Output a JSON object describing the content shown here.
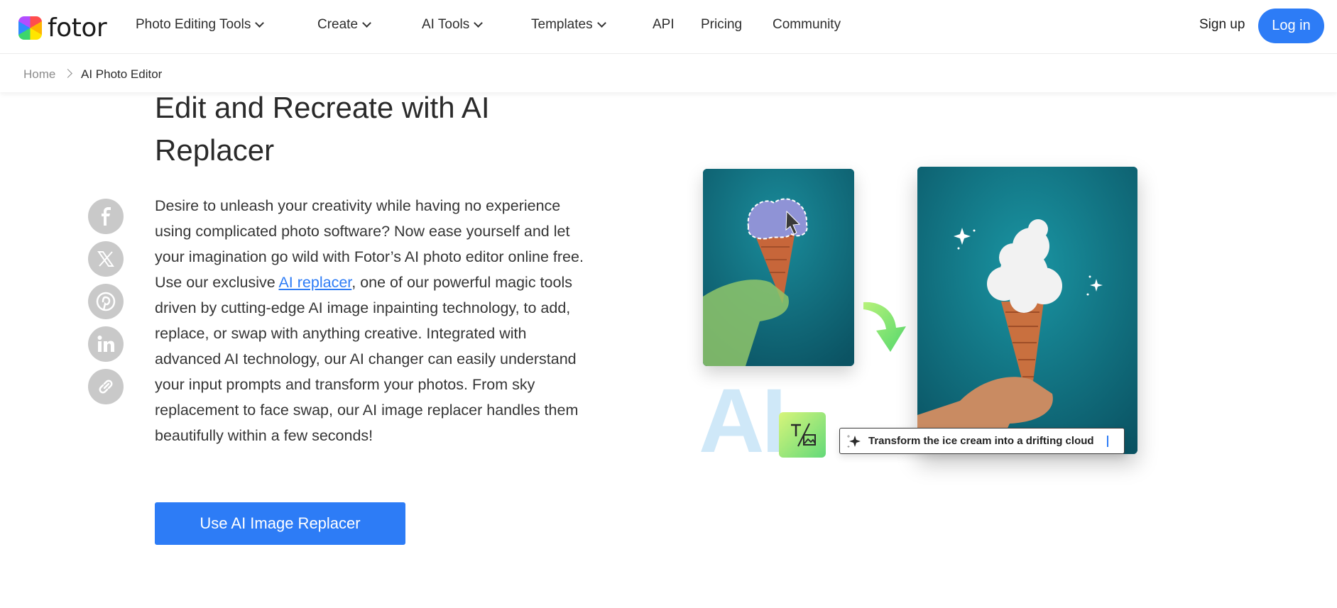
{
  "brand": {
    "name": "fotor"
  },
  "nav": {
    "items": [
      {
        "label": "Photo Editing Tools",
        "has_dropdown": true
      },
      {
        "label": "Create",
        "has_dropdown": true
      },
      {
        "label": "AI Tools",
        "has_dropdown": true
      },
      {
        "label": "Templates",
        "has_dropdown": true
      },
      {
        "label": "API",
        "has_dropdown": false
      },
      {
        "label": "Pricing",
        "has_dropdown": false
      },
      {
        "label": "Community",
        "has_dropdown": false
      }
    ],
    "signup_label": "Sign up",
    "login_label": "Log in"
  },
  "breadcrumb": {
    "home": "Home",
    "current": "AI Photo Editor"
  },
  "hero": {
    "title": "Edit and Recreate with AI Replacer",
    "paragraph_before_link": "Desire to unleash your creativity while having no experience using complicated photo software? Now ease yourself and let your imagination go wild with Fotor’s AI photo editor online free. Use our exclusive ",
    "link_text": "AI replacer",
    "paragraph_after_link": ", one of our powerful magic tools driven by cutting-edge AI image inpainting technology, to add, replace, or swap with anything creative. Integrated with advanced AI technology, our AI changer can easily understand your input prompts and transform your photos. From sky replacement to face swap, our AI image replacer handles them beautifully within a few seconds!",
    "cta_label": "Use AI Image Replacer"
  },
  "share": {
    "icons": [
      "facebook-icon",
      "x-twitter-icon",
      "pinterest-icon",
      "linkedin-icon",
      "copy-link-icon"
    ]
  },
  "illustration": {
    "ai_text": "AI",
    "prompt_text": "Transform the ice cream into a drifting cloud"
  },
  "colors": {
    "accent": "#2d7cf6",
    "share_icon_bg": "#c9c9c9",
    "illustration_teal": "#0f6e7e",
    "arrow_green": "#7fe36a"
  }
}
